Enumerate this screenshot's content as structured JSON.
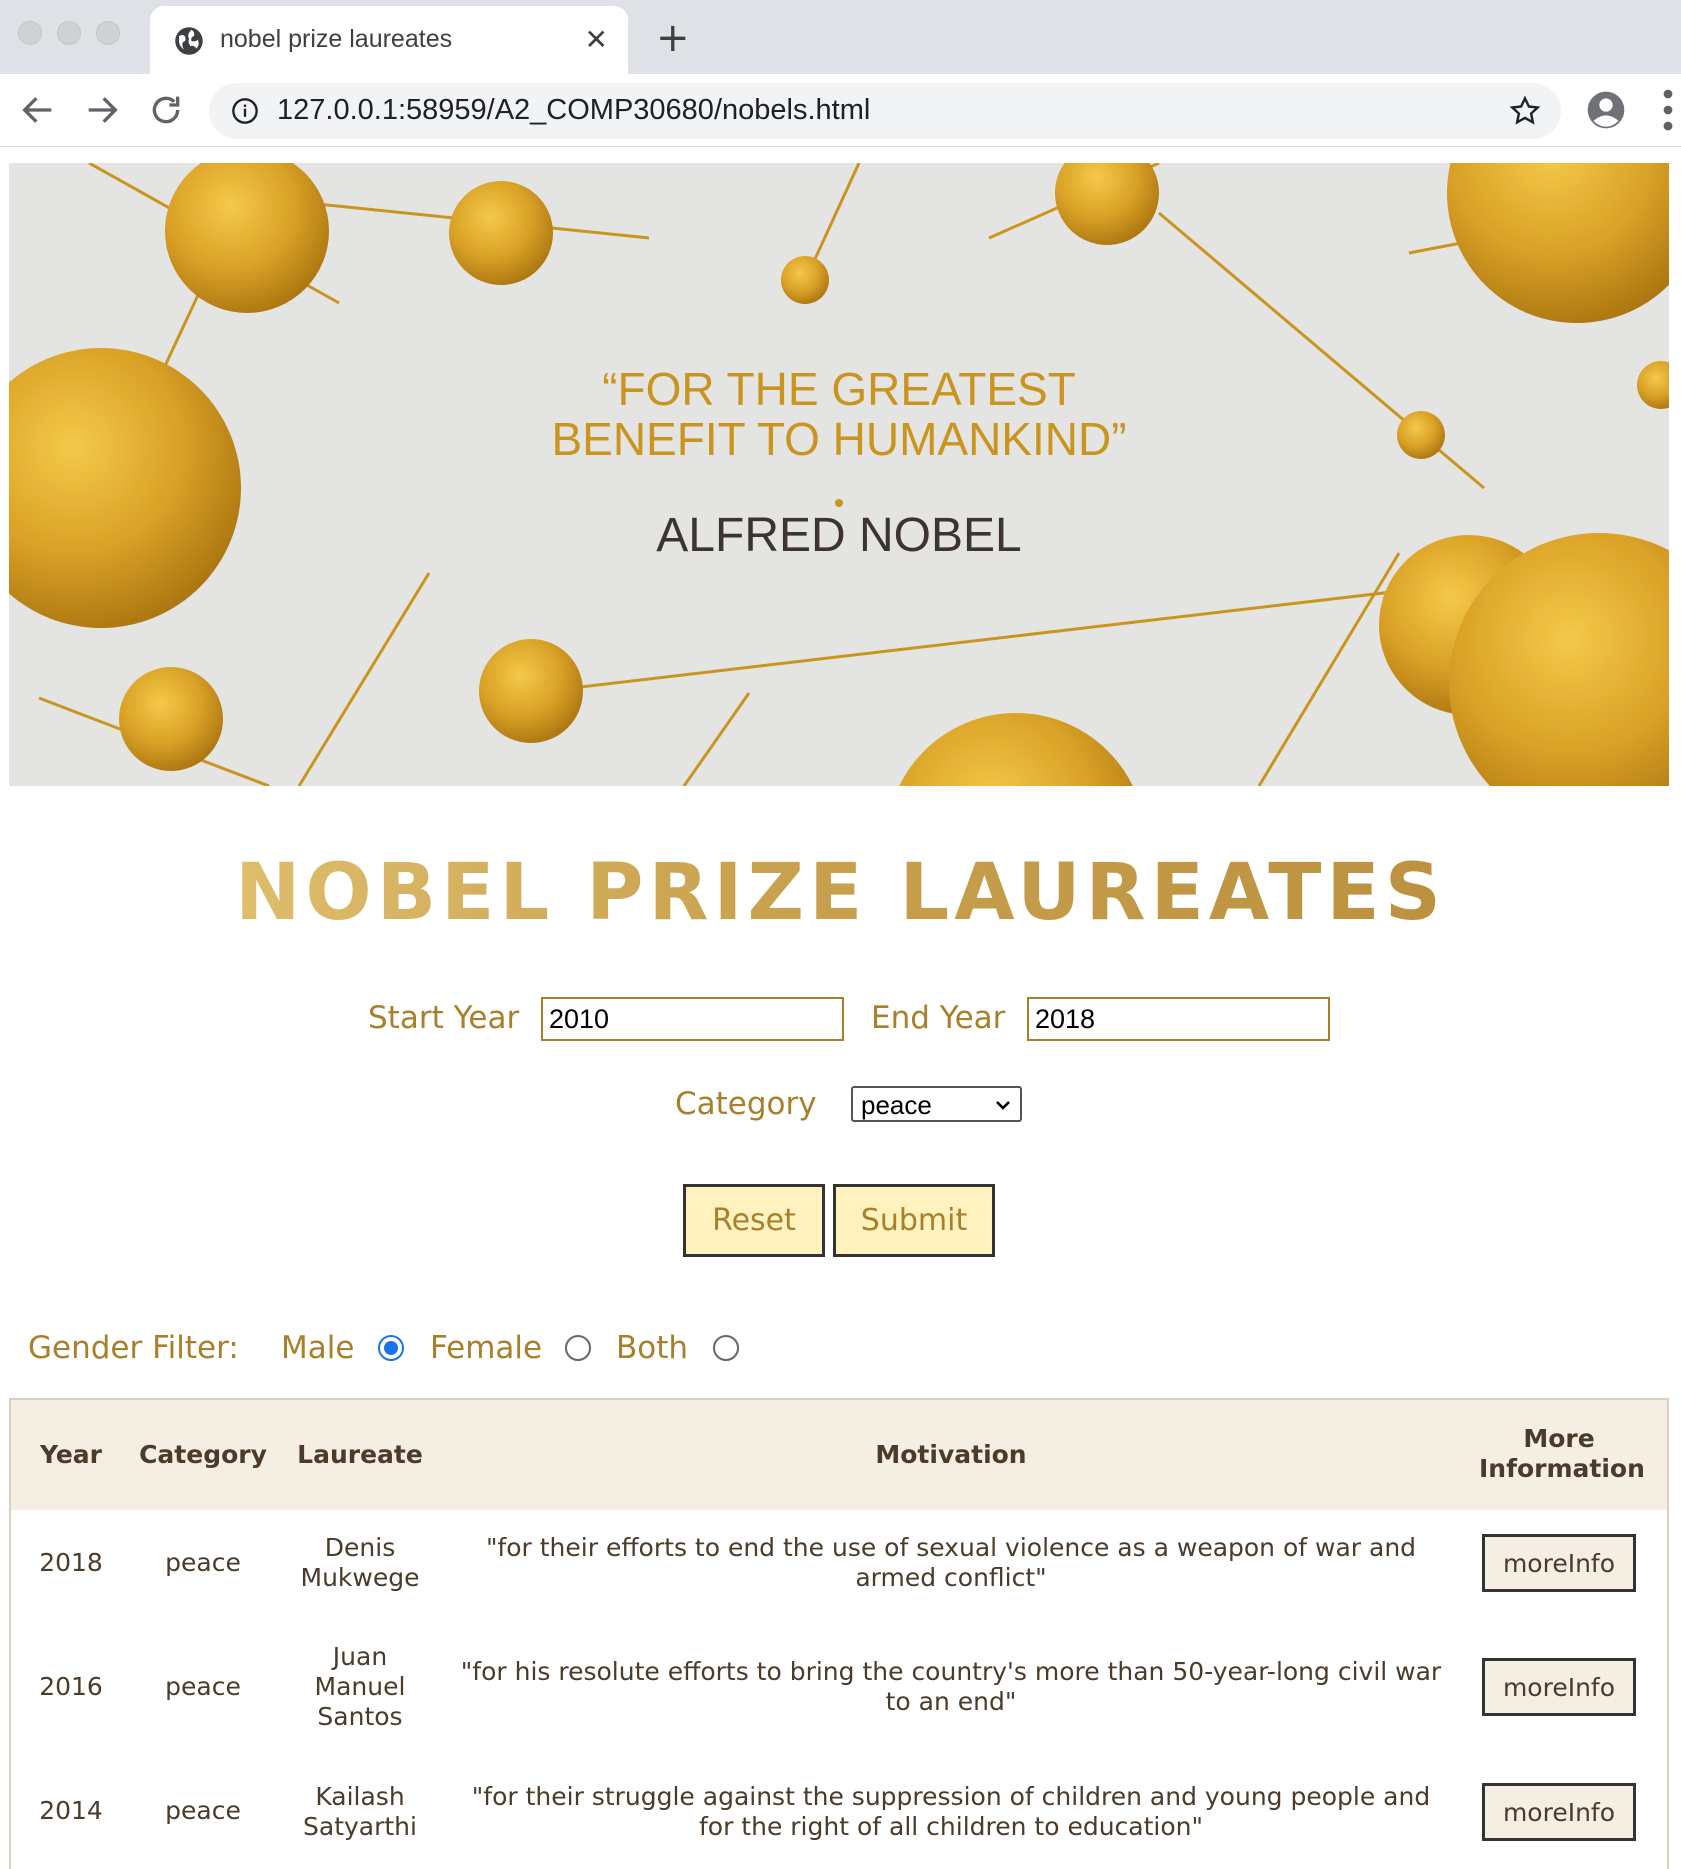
{
  "browser": {
    "tab_title": "nobel prize laureates",
    "tab_close": "✕",
    "new_tab": "+",
    "url": "127.0.0.1:58959/A2_COMP30680/nobels.html"
  },
  "banner": {
    "quote_line1": "“FOR THE GREATEST",
    "quote_line2": "BENEFIT TO HUMANKIND”",
    "author": "ALFRED NOBEL"
  },
  "page": {
    "title": "NOBEL PRIZE LAUREATES"
  },
  "form": {
    "start_year_label": "Start Year",
    "start_year_value": "2010",
    "end_year_label": "End Year",
    "end_year_value": "2018",
    "category_label": "Category",
    "category_value": "peace",
    "reset_label": "Reset",
    "submit_label": "Submit"
  },
  "gender_filter": {
    "label": "Gender Filter:",
    "options": [
      "Male",
      "Female",
      "Both"
    ],
    "selected": "Male"
  },
  "table": {
    "headers": [
      "Year",
      "Category",
      "Laureate",
      "Motivation",
      "More Information"
    ],
    "rows": [
      {
        "year": "2018",
        "category": "peace",
        "laureate": "Denis Mukwege",
        "motivation": "\"for their efforts to end the use of sexual violence as a weapon of war and armed conflict\"",
        "button": "moreInfo"
      },
      {
        "year": "2016",
        "category": "peace",
        "laureate": "Juan Manuel Santos",
        "motivation": "\"for his resolute efforts to bring the country's more than 50-year-long civil war to an end\"",
        "button": "moreInfo"
      },
      {
        "year": "2014",
        "category": "peace",
        "laureate": "Kailash Satyarthi",
        "motivation": "\"for their struggle against the suppression of children and young people and for the right of all children to education\"",
        "button": "moreInfo"
      }
    ]
  },
  "icons": {
    "tab": "globe-icon",
    "back": "arrow-left-icon",
    "forward": "arrow-right-icon",
    "reload": "reload-icon",
    "site_info": "info-icon",
    "bookmark": "star-icon",
    "profile": "avatar-icon",
    "menu": "menu-dots-icon",
    "dropdown": "chevron-down-icon"
  },
  "colors": {
    "gold_text": "#a8802c",
    "button_fill": "#fff2bf",
    "table_header_fill": "#f5eee2",
    "radio_accent": "#1a73e8"
  }
}
